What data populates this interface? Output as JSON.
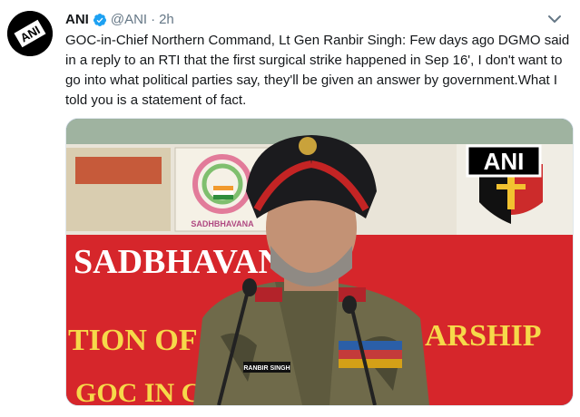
{
  "tweet": {
    "author_name": "ANI",
    "author_handle": "@ANI",
    "separator": "·",
    "time": "2h",
    "text": "GOC-in-Chief Northern Command, Lt Gen Ranbir Singh: Few days ago DGMO said in a reply to an RTI that the first surgical strike happened in Sep 16', I don't want to go into what political parties say, they'll be given an answer by government.What I told you is a statement of fact."
  },
  "avatar": {
    "logo_text": "ANI",
    "icon": "ani-logo-icon"
  },
  "icons": {
    "verified": "verified-badge-icon",
    "menu": "chevron-down-icon"
  },
  "media": {
    "watermark": "ANI",
    "banner_text_line1": "SADBHAVANA",
    "banner_text_line2": "TION OF ED",
    "banner_text_line2_right": "ARSHIP",
    "banner_text_line3": "GOC IN C N",
    "logo_caption": "SADHBHAVANA",
    "name_tag": "RANBIR SINGH"
  },
  "colors": {
    "accent_blue": "#1da1f2",
    "muted": "#657786",
    "banner_red": "#d6262b",
    "turban": "#1b1b1e"
  }
}
